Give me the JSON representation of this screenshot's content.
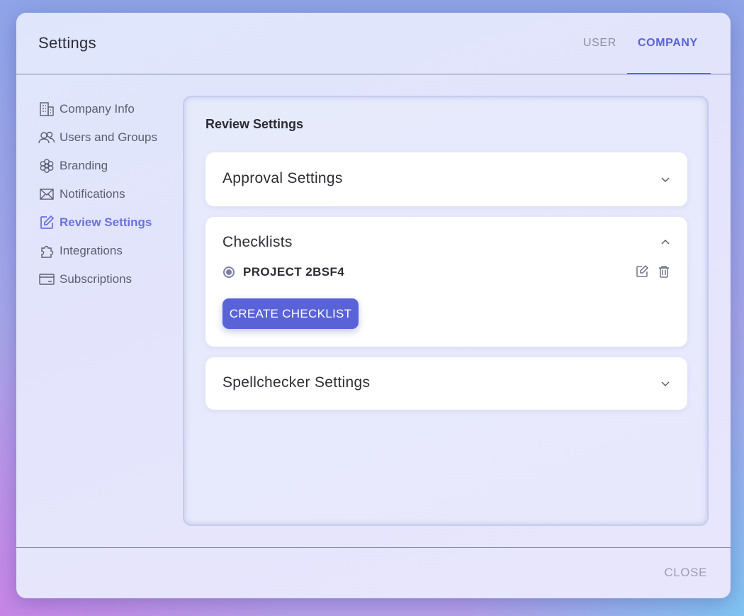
{
  "modal": {
    "title": "Settings",
    "tabs": [
      {
        "label": "USER",
        "active": false
      },
      {
        "label": "COMPANY",
        "active": true
      }
    ],
    "close_label": "CLOSE"
  },
  "sidebar": {
    "items": [
      {
        "label": "Company Info",
        "icon": "building-icon",
        "active": false
      },
      {
        "label": "Users and Groups",
        "icon": "users-icon",
        "active": false
      },
      {
        "label": "Branding",
        "icon": "flower-icon",
        "active": false
      },
      {
        "label": "Notifications",
        "icon": "envelope-icon",
        "active": false
      },
      {
        "label": "Review Settings",
        "icon": "edit-icon",
        "active": true
      },
      {
        "label": "Integrations",
        "icon": "puzzle-icon",
        "active": false
      },
      {
        "label": "Subscriptions",
        "icon": "card-icon",
        "active": false
      }
    ]
  },
  "main": {
    "title": "Review Settings",
    "sections": {
      "approval": {
        "title": "Approval Settings",
        "expanded": false
      },
      "checklists": {
        "title": "Checklists",
        "expanded": true,
        "items": [
          {
            "label": "PROJECT 2BSF4",
            "selected": true
          }
        ],
        "create_label": "CREATE CHECKLIST"
      },
      "spellchecker": {
        "title": "Spellchecker Settings",
        "expanded": false
      }
    }
  },
  "colors": {
    "accent": "#5a62d8",
    "active_nav": "#6a72de",
    "text": "#2d2d36",
    "muted": "#8a8ea6"
  }
}
